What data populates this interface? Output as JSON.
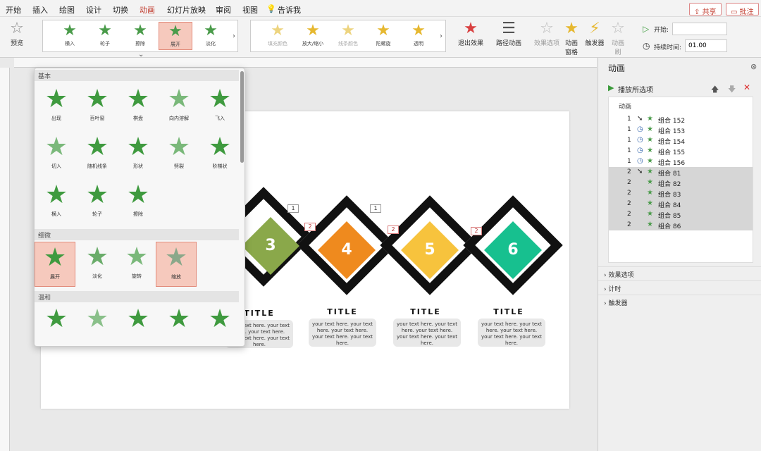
{
  "menu": [
    "开始",
    "插入",
    "绘图",
    "设计",
    "切换",
    "动画",
    "幻灯片放映",
    "审阅",
    "视图",
    "告诉我"
  ],
  "menu_active_index": 5,
  "top_buttons": {
    "share": "共享",
    "comment": "批注"
  },
  "ribbon": {
    "preview": "预览",
    "gallery1": [
      {
        "label": "横入",
        "selected": false
      },
      {
        "label": "轮子",
        "selected": false
      },
      {
        "label": "擦除",
        "selected": false
      },
      {
        "label": "展开",
        "selected": true
      },
      {
        "label": "淡化",
        "selected": false
      }
    ],
    "gallery2": [
      {
        "label": "填充颜色"
      },
      {
        "label": "放大/缩小"
      },
      {
        "label": "线条颜色"
      },
      {
        "label": "陀螺旋"
      },
      {
        "label": "透明"
      }
    ],
    "exit_effect": "退出效果",
    "path_anim": "路径动画",
    "effect_options": "效果选项",
    "anim_pane": "动画窗格",
    "trigger": "触发器",
    "anim_brush": "动画刷",
    "start_label": "开始:",
    "start_value": "",
    "duration_label": "持续时间:",
    "duration_value": "01.00"
  },
  "dropdown": {
    "basic_title": "基本",
    "basic": [
      "出现",
      "百叶窗",
      "棋盘",
      "向内溶解",
      "飞入",
      "切入",
      "随机线条",
      "形状",
      "劈裂",
      "阶梯状",
      "横入",
      "轮子",
      "擦除"
    ],
    "subtle_title": "细微",
    "subtle": [
      {
        "label": "展开",
        "selected": true
      },
      {
        "label": "淡化",
        "selected": false
      },
      {
        "label": "旋转",
        "selected": false
      },
      {
        "label": "缩放",
        "selected": true
      }
    ],
    "moderate_title": "温和"
  },
  "slide": {
    "steps": [
      {
        "num": "3",
        "color": "#8aa84a",
        "title": "TITLE",
        "text": "your text here. your text here. your text here. your text here. your text here."
      },
      {
        "num": "4",
        "color": "#ef8a1e",
        "title": "TITLE",
        "text": "your text here. your text here. your text here. your text here. your text here."
      },
      {
        "num": "5",
        "color": "#f7c33d",
        "title": "TITLE",
        "text": "your text here. your text here. your text here. your text here. your text here."
      },
      {
        "num": "6",
        "color": "#17c08f",
        "title": "TITLE",
        "text": "your text here. your text here. your text here. your text here. your text here."
      }
    ],
    "tags": [
      "1",
      "2",
      "1",
      "2",
      "2"
    ]
  },
  "pane": {
    "title": "动画",
    "play": "播放所选项",
    "list_header": "动画",
    "rows": [
      {
        "n": "1",
        "label": "组合 152",
        "clock": false
      },
      {
        "n": "1",
        "label": "组合 153",
        "clock": true
      },
      {
        "n": "1",
        "label": "组合 154",
        "clock": true
      },
      {
        "n": "1",
        "label": "组合 155",
        "clock": true
      },
      {
        "n": "1",
        "label": "组合 156",
        "clock": true
      },
      {
        "n": "2",
        "label": "组合 81",
        "clock": false
      },
      {
        "n": "2",
        "label": "组合 82",
        "clock": false
      },
      {
        "n": "2",
        "label": "组合 83",
        "clock": false
      },
      {
        "n": "2",
        "label": "组合 84",
        "clock": false
      },
      {
        "n": "2",
        "label": "组合 85",
        "clock": false
      },
      {
        "n": "2",
        "label": "组合 86",
        "clock": false
      }
    ],
    "sections": [
      "效果选项",
      "计时",
      "触发器"
    ]
  }
}
